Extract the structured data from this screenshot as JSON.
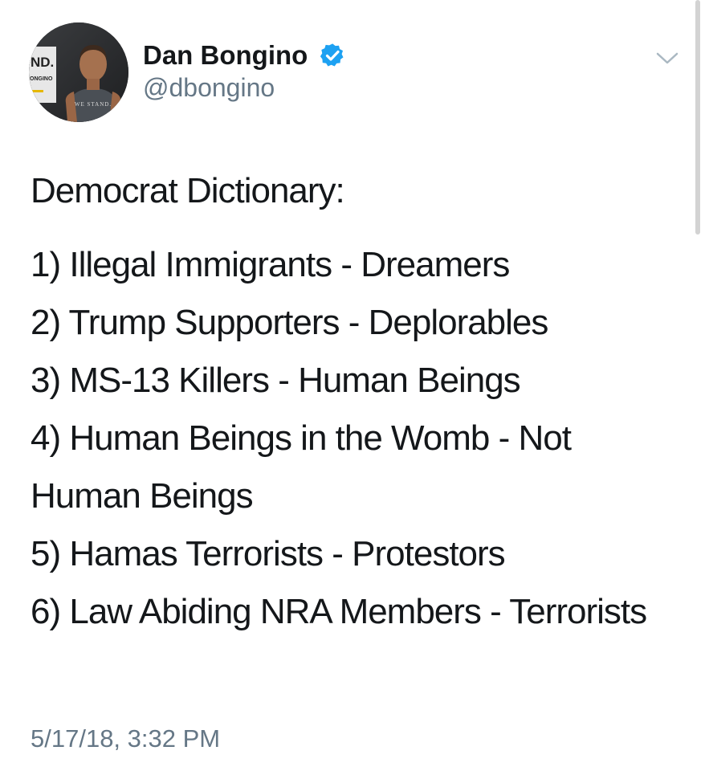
{
  "tweet": {
    "author": {
      "display_name": "Dan Bongino",
      "handle": "@dbongino",
      "verified": true,
      "avatar_text": {
        "logo": "ND.",
        "sub": "ONGINO",
        "shirt": "WE STAND."
      }
    },
    "menu_icon": "chevron-down-icon",
    "text": {
      "heading": "Democrat Dictionary:",
      "items": [
        "1) Illegal Immigrants - Dreamers",
        "2) Trump Supporters - Deplorables",
        "3) MS-13 Killers - Human Beings",
        "4) Human Beings in the Womb - Not Human Beings",
        "5) Hamas Terrorists - Protestors",
        "6) Law Abiding NRA Members - Terrorists"
      ]
    },
    "timestamp": "5/17/18, 3:32 PM"
  },
  "colors": {
    "text_primary": "#14171a",
    "text_secondary": "#657786",
    "verified_blue": "#1da1f2",
    "chevron_gray": "#aab8c2"
  }
}
